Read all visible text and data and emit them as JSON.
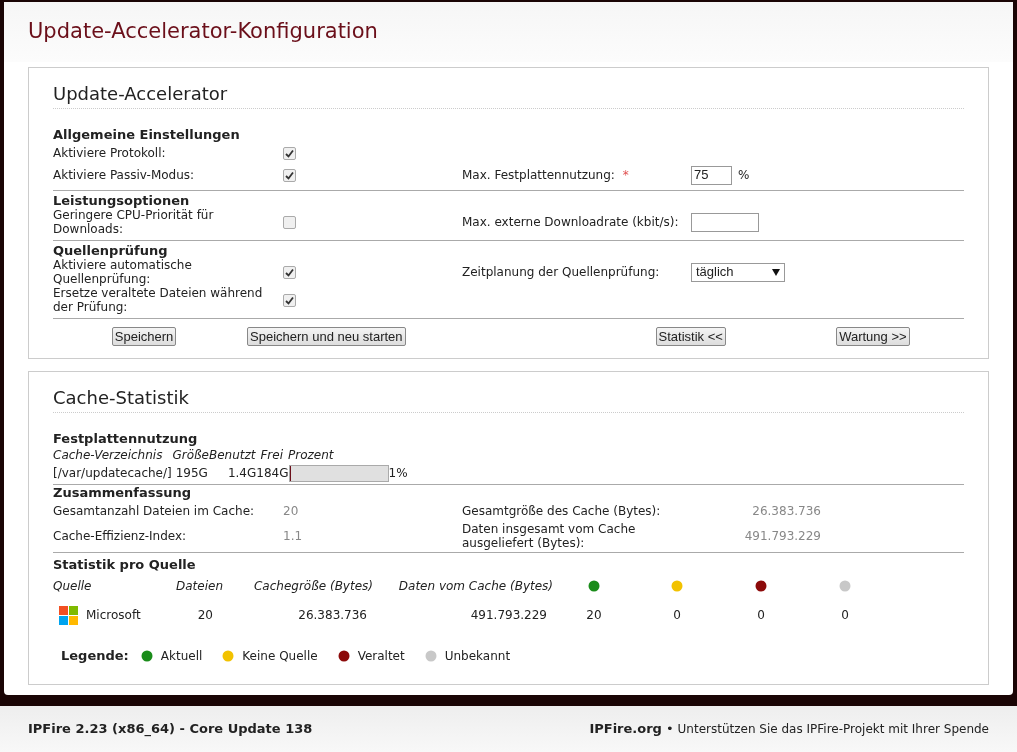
{
  "page": {
    "title": "Update-Accelerator-Konfiguration"
  },
  "config": {
    "title": "Update-Accelerator",
    "sections": [
      {
        "heading": "Allgemeine Einstellungen",
        "rows": [
          {
            "label": "Aktiviere Protokoll:",
            "checked": true
          },
          {
            "label": "Aktiviere Passiv-Modus:",
            "checked": true,
            "right": {
              "kind": "text",
              "label": "Max. Festplattennutzung:",
              "required": "*",
              "value": "75",
              "unit": "%"
            }
          }
        ]
      },
      {
        "heading": "Leistungsoptionen",
        "rows": [
          {
            "label": "Geringere CPU-Priorität für Downloads:",
            "checked": false,
            "right": {
              "kind": "text",
              "label": "Max. externe Downloadrate (kbit/s):"
            }
          }
        ]
      },
      {
        "heading": "Quellenprüfung",
        "rows": [
          {
            "label": "Aktiviere automatische Quellenprüfung:",
            "checked": true,
            "right": {
              "kind": "select",
              "label": "Zeitplanung der Quellenprüfung:",
              "value": "täglich"
            }
          },
          {
            "label": "Ersetze veraltete Dateien während der Prüfung:",
            "checked": true
          }
        ]
      }
    ],
    "buttons": [
      {
        "label": "Speichern"
      },
      {
        "label": "Speichern und neu starten"
      },
      {
        "label": "Statistik <<"
      },
      {
        "label": "Wartung >>"
      }
    ]
  },
  "stats": {
    "title": "Cache-Statistik",
    "disk": {
      "heading": "Festplattennutzung",
      "columns": [
        "Cache-Verzeichnis",
        "Größe",
        "Benutzt",
        "Frei",
        "Prozent"
      ],
      "row": {
        "directory": "[/var/updatecache/]",
        "size": "195G",
        "used": "1.4G",
        "free": "184G",
        "level": 0.01,
        "percent": "1%"
      }
    },
    "summary": {
      "heading": "Zusammenfassung",
      "items": [
        {
          "label": "Gesamtanzahl Dateien im Cache:",
          "value": "20"
        },
        {
          "label": "Gesamtgröße des Cache (Bytes):",
          "value": "26.383.736"
        },
        {
          "label": "Cache-Effizienz-Index:",
          "value": "1.1"
        },
        {
          "label": "Daten insgesamt vom Cache ausgeliefert (Bytes):",
          "value": "491.793.229"
        }
      ]
    },
    "sources": {
      "heading": "Statistik pro Quelle",
      "columns": [
        {
          "kind": "text",
          "label": "Quelle"
        },
        {
          "kind": "text",
          "label": "Dateien"
        },
        {
          "kind": "text",
          "label": "Cachegröße (Bytes)"
        },
        {
          "kind": "text",
          "label": "Daten vom Cache (Bytes)"
        },
        {
          "kind": "dot",
          "color": "#1a8c1a"
        },
        {
          "kind": "dot",
          "color": "#f2c200"
        },
        {
          "kind": "dot",
          "color": "#8c0a0a"
        },
        {
          "kind": "dot",
          "color": "#c8c8c8"
        }
      ],
      "rows": [
        {
          "name": "Microsoft",
          "files": "20",
          "cache_size": "26.383.736",
          "delivered": "491.793.229",
          "counts": [
            "20",
            "0",
            "0",
            "0"
          ]
        }
      ]
    },
    "legend": {
      "label": "Legende:",
      "items": [
        {
          "label": "Aktuell",
          "color": "#1a8c1a"
        },
        {
          "label": "Keine Quelle",
          "color": "#f2c200"
        },
        {
          "label": "Veraltet",
          "color": "#8c0a0a"
        },
        {
          "label": "Unbekannt",
          "color": "#c8c8c8"
        }
      ]
    }
  },
  "footer": {
    "version": "IPFire 2.23 (x86_64) - Core Update 138",
    "link": "IPFire.org",
    "separator": "•",
    "text": "Unterstützen Sie das IPFire-Projekt mit Ihrer Spende"
  }
}
